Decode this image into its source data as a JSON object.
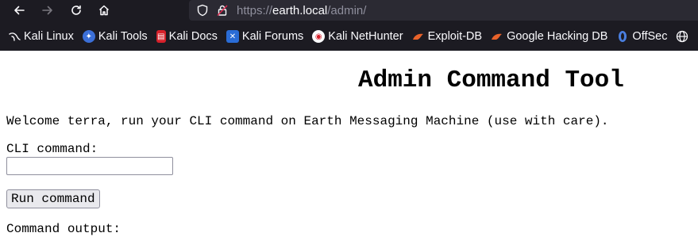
{
  "browser": {
    "url_prefix": "https://",
    "url_host": "earth.local",
    "url_path": "/admin/",
    "bookmarks": [
      {
        "label": "Kali Linux",
        "icon": "kali-dragon-icon"
      },
      {
        "label": "Kali Tools",
        "icon": "kali-tools-icon"
      },
      {
        "label": "Kali Docs",
        "icon": "kali-docs-icon"
      },
      {
        "label": "Kali Forums",
        "icon": "kali-forums-icon"
      },
      {
        "label": "Kali NetHunter",
        "icon": "nethunter-icon"
      },
      {
        "label": "Exploit-DB",
        "icon": "exploit-db-icon"
      },
      {
        "label": "Google Hacking DB",
        "icon": "ghdb-icon"
      },
      {
        "label": "OffSec",
        "icon": "offsec-icon"
      }
    ]
  },
  "page": {
    "title": "Admin Command Tool",
    "welcome": "Welcome terra, run your CLI command on Earth Messaging Machine (use with care).",
    "cli_label": "CLI command:",
    "cli_value": "",
    "run_button": "Run command",
    "output_label": "Command output:"
  }
}
